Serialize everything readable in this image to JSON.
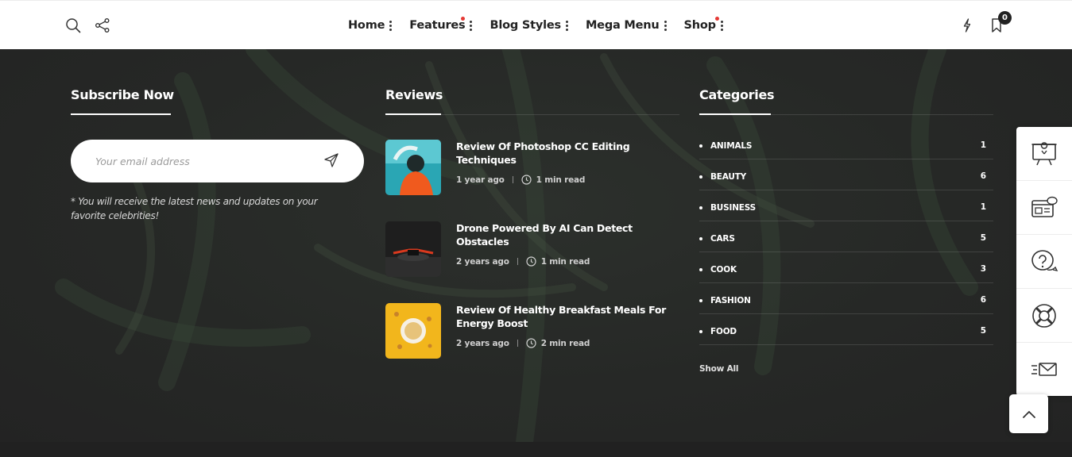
{
  "header": {
    "nav": [
      {
        "label": "Home",
        "dot": false
      },
      {
        "label": "Features",
        "dot": true
      },
      {
        "label": "Blog Styles",
        "dot": false
      },
      {
        "label": "Mega Menu",
        "dot": false
      },
      {
        "label": "Shop",
        "dot": true
      }
    ],
    "icons": [
      "search-icon",
      "share-icon",
      "flash-icon",
      "bookmark-icon"
    ],
    "bookmark_count": "0"
  },
  "subscribe": {
    "title": "Subscribe Now",
    "placeholder": "Your email address",
    "note": "* You will receive the latest news and updates on your favorite celebrities!"
  },
  "reviews": {
    "title": "Reviews",
    "items": [
      {
        "title": "Review Of Photoshop CC Editing Techniques",
        "date": "1 year ago",
        "read": "1 min read"
      },
      {
        "title": "Drone Powered By AI Can Detect Obstacles",
        "date": "2 years ago",
        "read": "1 min read"
      },
      {
        "title": "Review Of Healthy Breakfast Meals For Energy Boost",
        "date": "2 years ago",
        "read": "2 min read"
      }
    ]
  },
  "categories": {
    "title": "Categories",
    "items": [
      {
        "name": "ANIMALS",
        "count": "1"
      },
      {
        "name": "BEAUTY",
        "count": "6"
      },
      {
        "name": "BUSINESS",
        "count": "1"
      },
      {
        "name": "CARS",
        "count": "5"
      },
      {
        "name": "COOK",
        "count": "3"
      },
      {
        "name": "FASHION",
        "count": "6"
      },
      {
        "name": "FOOD",
        "count": "5"
      }
    ],
    "show_all": "Show All"
  },
  "side_panel": [
    "presentation-icon",
    "browser-chat-icon",
    "help-chat-icon",
    "lifebuoy-icon",
    "fast-mail-icon"
  ],
  "colors": {
    "accent_dot": "#e53935",
    "footer_bg": "#232323",
    "header_bg": "#ffffff"
  }
}
